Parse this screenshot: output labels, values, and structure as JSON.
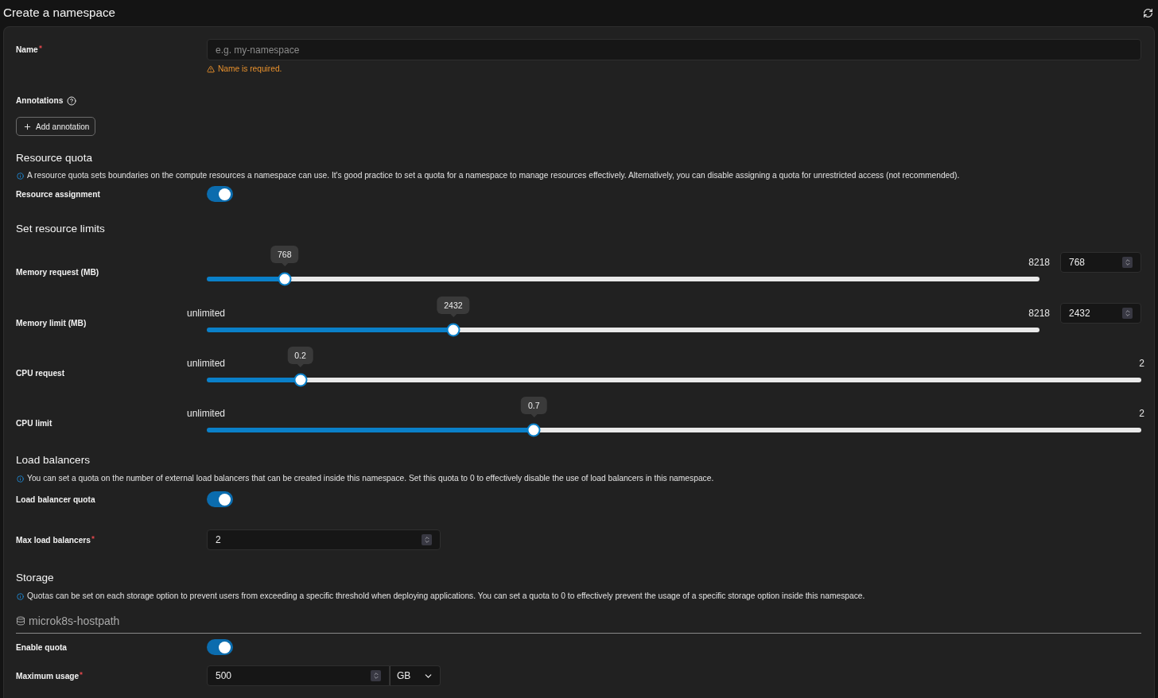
{
  "header": {
    "title": "Create a namespace"
  },
  "name_field": {
    "label": "Name",
    "required": true,
    "placeholder": "e.g. my-namespace",
    "error": "Name is required."
  },
  "annotations": {
    "label": "Annotations",
    "add_button": "Add annotation"
  },
  "resource_quota": {
    "heading": "Resource quota",
    "info": "A resource quota sets boundaries on the compute resources a namespace can use. It's good practice to set a quota for a namespace to manage resources effectively. Alternatively, you can disable assigning a quota for unrestricted access (not recommended).",
    "toggle": {
      "label": "Resource assignment",
      "on": true
    }
  },
  "resource_limits": {
    "heading": "Set resource limits",
    "sliders": [
      {
        "label": "Memory request (MB)",
        "tooltip": "768",
        "max_label": "8218",
        "level": 0.0934,
        "input_value": "768"
      },
      {
        "label": "Memory limit (MB)",
        "min_label": "unlimited",
        "tooltip": "2432",
        "max_label": "8218",
        "level": 0.296,
        "input_value": "2432"
      },
      {
        "label": "CPU request",
        "min_label": "unlimited",
        "tooltip": "0.2",
        "max_label": "2",
        "level": 0.1
      },
      {
        "label": "CPU limit",
        "min_label": "unlimited",
        "tooltip": "0.7",
        "max_label": "2",
        "level": 0.35
      }
    ]
  },
  "load_balancers": {
    "heading": "Load balancers",
    "info": "You can set a quota on the number of external load balancers that can be created inside this namespace. Set this quota to 0 to effectively disable the use of load balancers in this namespace.",
    "toggle": {
      "label": "Load balancer quota",
      "on": true
    },
    "max_field": {
      "label": "Max load balancers",
      "required": true,
      "value": "2"
    }
  },
  "storage": {
    "heading": "Storage",
    "info": "Quotas can be set on each storage option to prevent users from exceeding a specific threshold when deploying applications. You can set a quota to 0 to effectively prevent the usage of a specific storage option inside this namespace.",
    "classes": [
      {
        "name": "microk8s-hostpath",
        "toggle": {
          "label": "Enable quota",
          "on": true
        },
        "max_usage": {
          "label": "Maximum usage",
          "required": true,
          "value": "500",
          "unit": "GB"
        }
      }
    ]
  }
}
